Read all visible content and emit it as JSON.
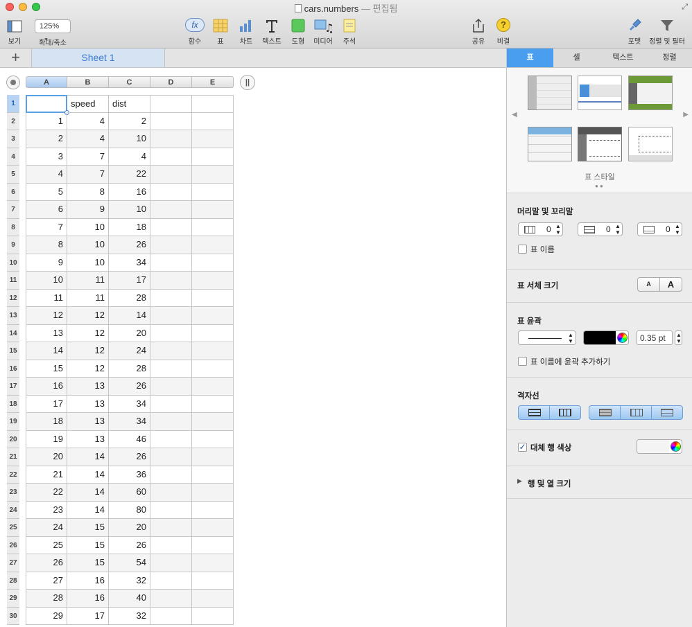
{
  "window": {
    "filename": "cars.numbers",
    "status": "— 편집됨"
  },
  "toolbar": {
    "view": "보기",
    "zoom_value": "125%",
    "zoom": "확대/축소",
    "function": "함수",
    "function_badge": "fx",
    "table": "표",
    "chart": "차트",
    "text": "텍스트",
    "shape": "도형",
    "media": "미디어",
    "comment": "주석",
    "share": "공유",
    "tips": "비결",
    "format": "포맷",
    "sort_filter": "정렬 및 필터"
  },
  "sheet": {
    "name": "Sheet 1",
    "add": "+"
  },
  "columns": [
    "A",
    "B",
    "C",
    "D",
    "E"
  ],
  "rows": [
    [
      "",
      "speed",
      "dist"
    ],
    [
      "1",
      "4",
      "2"
    ],
    [
      "2",
      "4",
      "10"
    ],
    [
      "3",
      "7",
      "4"
    ],
    [
      "4",
      "7",
      "22"
    ],
    [
      "5",
      "8",
      "16"
    ],
    [
      "6",
      "9",
      "10"
    ],
    [
      "7",
      "10",
      "18"
    ],
    [
      "8",
      "10",
      "26"
    ],
    [
      "9",
      "10",
      "34"
    ],
    [
      "10",
      "11",
      "17"
    ],
    [
      "11",
      "11",
      "28"
    ],
    [
      "12",
      "12",
      "14"
    ],
    [
      "13",
      "12",
      "20"
    ],
    [
      "14",
      "12",
      "24"
    ],
    [
      "15",
      "12",
      "28"
    ],
    [
      "16",
      "13",
      "26"
    ],
    [
      "17",
      "13",
      "34"
    ],
    [
      "18",
      "13",
      "34"
    ],
    [
      "19",
      "13",
      "46"
    ],
    [
      "20",
      "14",
      "26"
    ],
    [
      "21",
      "14",
      "36"
    ],
    [
      "22",
      "14",
      "60"
    ],
    [
      "23",
      "14",
      "80"
    ],
    [
      "24",
      "15",
      "20"
    ],
    [
      "25",
      "15",
      "26"
    ],
    [
      "26",
      "15",
      "54"
    ],
    [
      "27",
      "16",
      "32"
    ],
    [
      "28",
      "16",
      "40"
    ],
    [
      "29",
      "17",
      "32"
    ]
  ],
  "inspector": {
    "tabs": [
      "표",
      "셀",
      "텍스트",
      "정렬"
    ],
    "table_styles_label": "표 스타일",
    "header_footer": {
      "title": "머리말 및 꼬리말",
      "header_rows": "0",
      "header_cols": "0",
      "footer_rows": "0",
      "table_name": "표 이름"
    },
    "font_size": {
      "title": "표 서체 크기",
      "small": "A",
      "large": "A"
    },
    "outline": {
      "title": "표 윤곽",
      "width": "0.35 pt",
      "outline_name": "표 이름에 윤곽 추가하기",
      "color": "#000000"
    },
    "gridlines": {
      "title": "격자선"
    },
    "alt_rows": {
      "title": "대체 행 색상",
      "checked": true,
      "mark": "✓"
    },
    "row_col_size": {
      "title": "행 및 열 크기"
    }
  },
  "colors": {
    "accent": "#4a9eef",
    "selection": "#3a7bd5",
    "style_green": "#6c9a37"
  }
}
